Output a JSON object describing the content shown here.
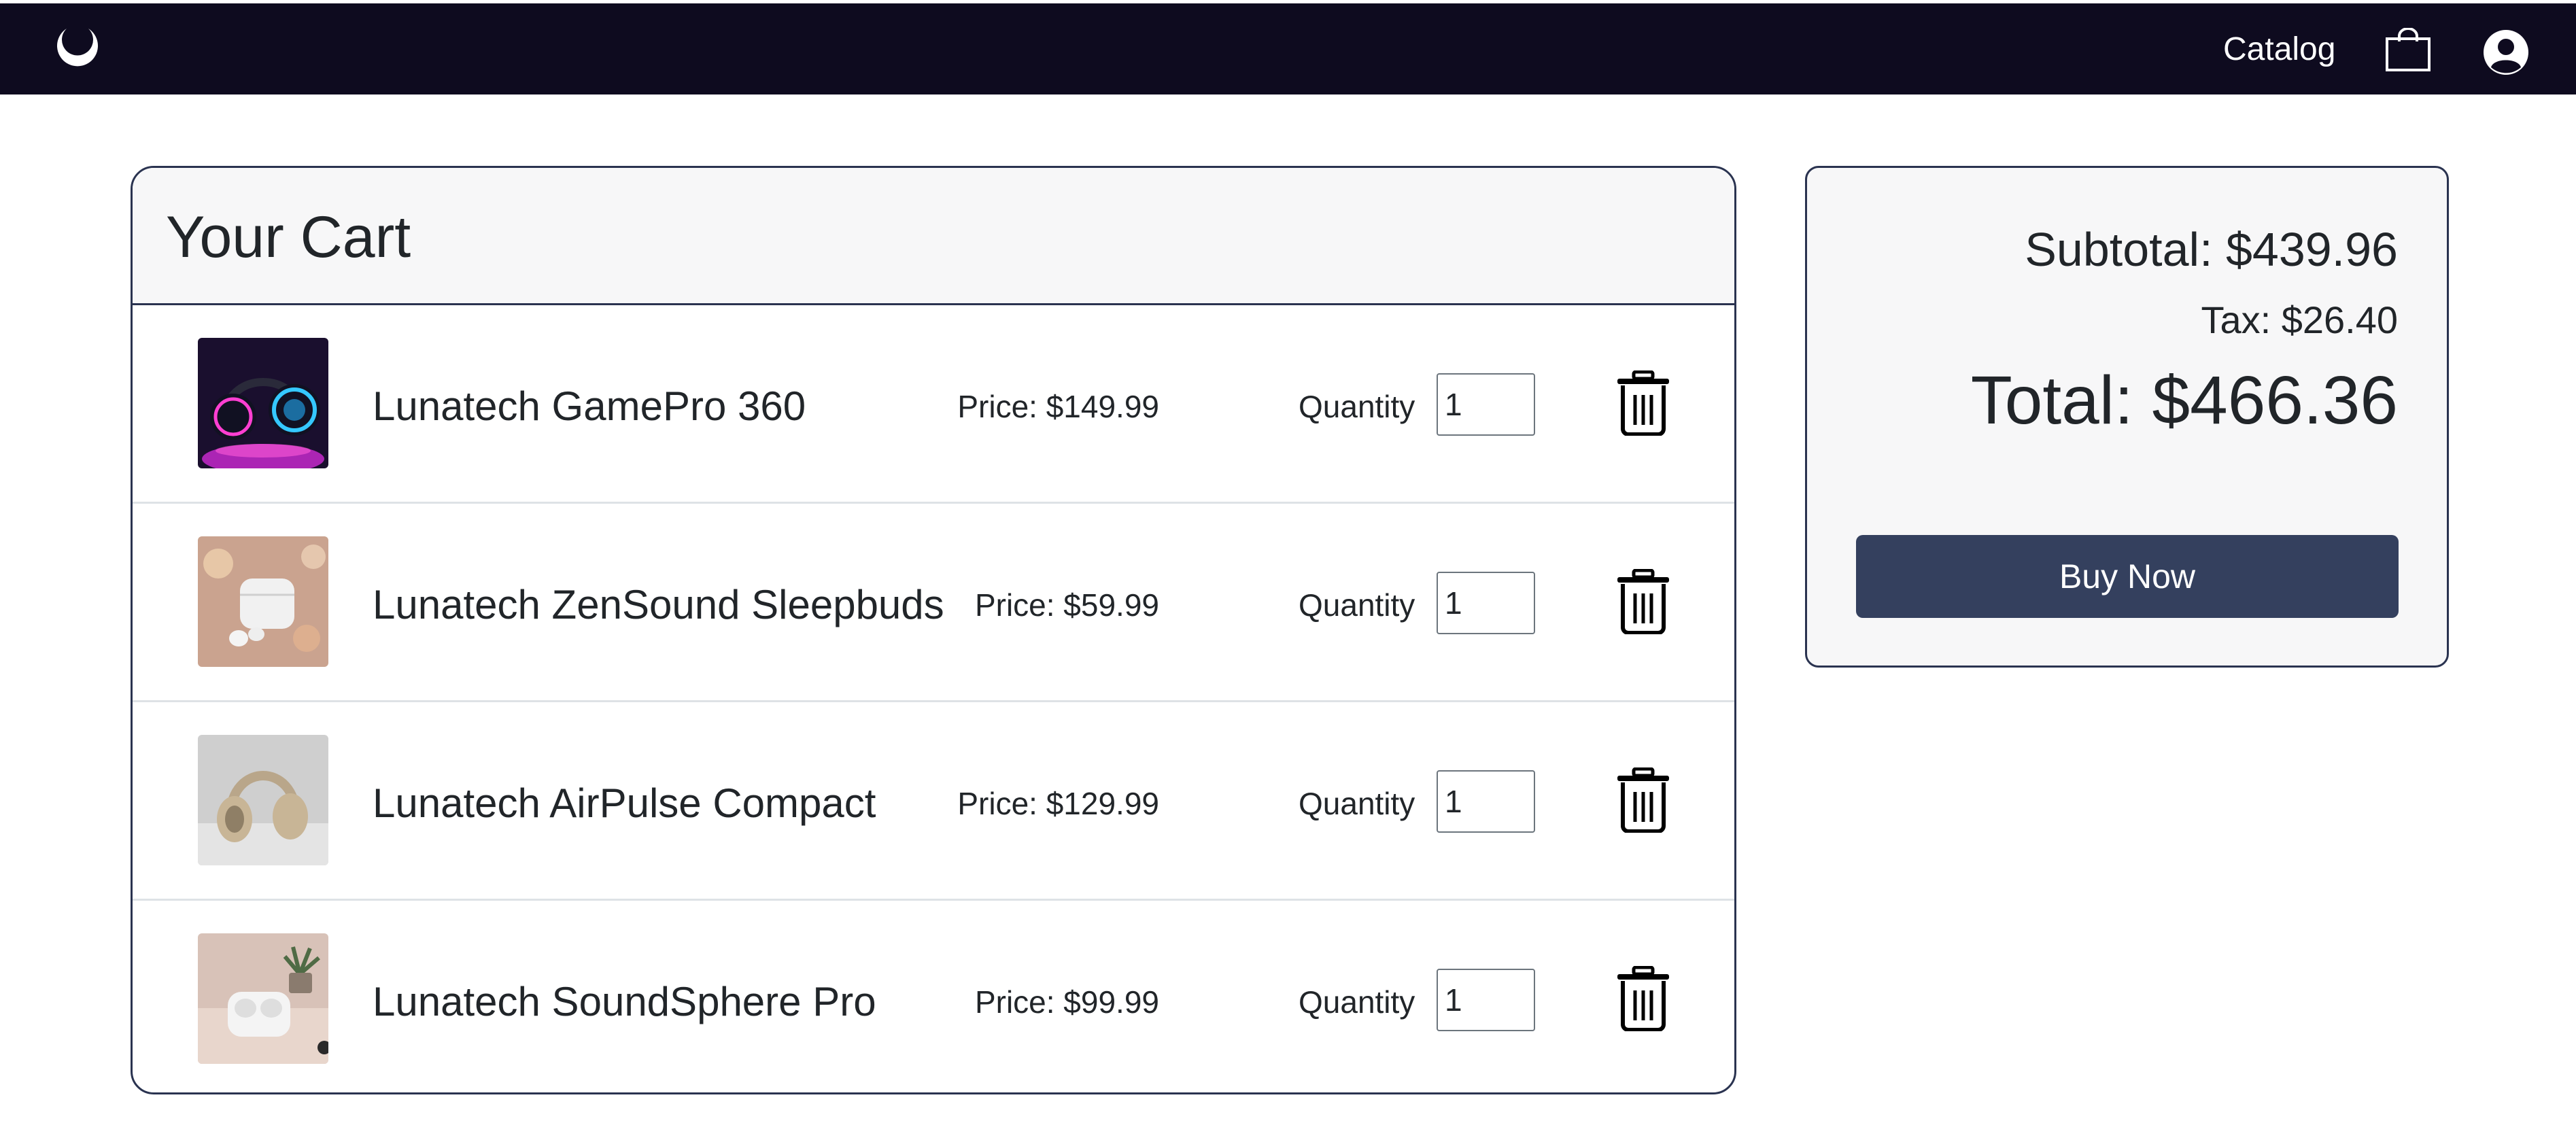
{
  "navbar": {
    "logo_icon": "crescent-moon-logo-icon",
    "catalog_label": "Catalog",
    "cart_icon": "shopping-bag-icon",
    "account_icon": "user-avatar-icon",
    "background_color": "#0e0b1f"
  },
  "cart": {
    "title": "Your Cart",
    "quantity_label": "Quantity",
    "delete_icon": "trash-icon",
    "items": [
      {
        "name": "Lunatech GamePro 360",
        "price": "Price: $149.99",
        "quantity": "1",
        "image": "neon-gaming-headphones"
      },
      {
        "name": "Lunatech ZenSound Sleepbuds",
        "price": "Price: $59.99",
        "quantity": "1",
        "image": "white-earbuds-case-warm"
      },
      {
        "name": "Lunatech AirPulse Compact",
        "price": "Price: $129.99",
        "quantity": "1",
        "image": "beige-over-ear-headphones"
      },
      {
        "name": "Lunatech SoundSphere Pro",
        "price": "Price: $99.99",
        "quantity": "1",
        "image": "white-earbuds-case-plant"
      }
    ]
  },
  "summary": {
    "subtotal": "Subtotal: $439.96",
    "tax": "Tax: $26.40",
    "total": "Total: $466.36",
    "buy_label": "Buy Now",
    "button_color": "#34405e"
  }
}
